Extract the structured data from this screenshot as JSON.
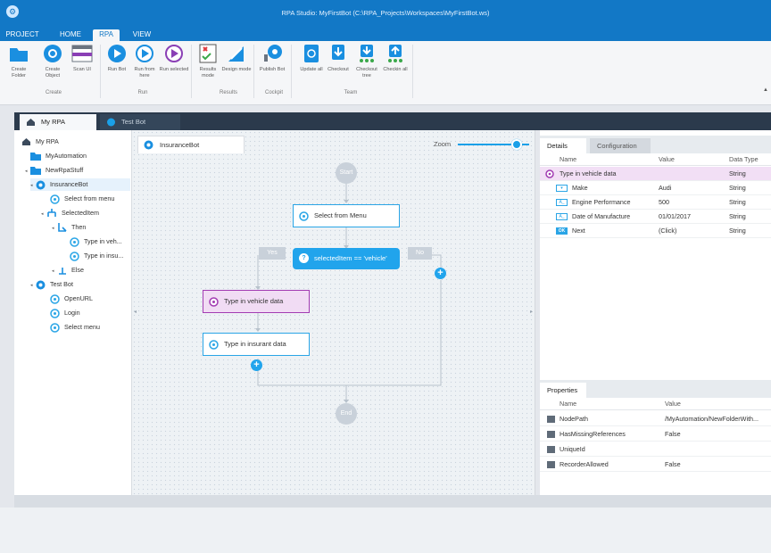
{
  "window": {
    "title": "RPA Studio: MyFirstBot (C:\\RPA_Projects\\Workspaces\\MyFirstBot.ws)"
  },
  "menu_tabs": [
    {
      "label": "PROJECT"
    },
    {
      "label": "HOME"
    },
    {
      "label": "RPA"
    },
    {
      "label": "VIEW"
    }
  ],
  "ribbon": {
    "groups": [
      {
        "label": "Create"
      },
      {
        "label": "Run"
      },
      {
        "label": "Results"
      },
      {
        "label": "Cockpit"
      },
      {
        "label": "Team"
      }
    ],
    "buttons": [
      {
        "label": "Create Folder",
        "icon": "folder-icon"
      },
      {
        "label": "Create Object",
        "icon": "gear-icon"
      },
      {
        "label": "Scan UI",
        "icon": "scan-ui-icon"
      },
      {
        "label": "Run Bot",
        "icon": "play-icon"
      },
      {
        "label": "Run from here",
        "icon": "play-outline-icon"
      },
      {
        "label": "Run selected",
        "icon": "play-selected-icon"
      },
      {
        "label": "Results mode",
        "icon": "results-mode-icon"
      },
      {
        "label": "Design mode",
        "icon": "design-mode-icon"
      },
      {
        "label": "Publish Bot",
        "icon": "publish-icon"
      },
      {
        "label": "Update all",
        "icon": "update-icon"
      },
      {
        "label": "Checkout",
        "icon": "checkout-icon"
      },
      {
        "label": "Checkout tree",
        "icon": "checkout-tree-icon"
      },
      {
        "label": "Checkin all",
        "icon": "checkin-icon"
      }
    ]
  },
  "workspace_tabs": [
    {
      "label": "My RPA"
    },
    {
      "label": "Test Bot"
    }
  ],
  "tree": [
    {
      "label": "My RPA"
    },
    {
      "label": "MyAutomation"
    },
    {
      "label": "NewRpaStuff"
    },
    {
      "label": "InsuranceBot"
    },
    {
      "label": "Select from menu"
    },
    {
      "label": "SelectedItem"
    },
    {
      "label": "Then"
    },
    {
      "label": "Type in veh..."
    },
    {
      "label": "Type in insu..."
    },
    {
      "label": "Else"
    },
    {
      "label": "Test Bot"
    },
    {
      "label": "OpenURL"
    },
    {
      "label": "Login"
    },
    {
      "label": "Select menu"
    }
  ],
  "canvas": {
    "tab_label": "InsuranceBot",
    "zoom_label": "Zoom",
    "zoom_level": 0.75,
    "start_label": "Start",
    "end_label": "End",
    "yes_label": "Yes",
    "no_label": "No",
    "nodes": {
      "select_menu": "Select from Menu",
      "condition": "selectedItem == 'vehicle'",
      "type_vehicle": "Type in vehicle data",
      "type_insurant": "Type in insurant data"
    }
  },
  "details": {
    "tabs": [
      {
        "label": "Details"
      },
      {
        "label": "Configuration"
      }
    ],
    "columns": {
      "name": "Name",
      "value": "Value",
      "type": "Data Type"
    },
    "rows": [
      {
        "name": "Type in vehicle data",
        "value": "",
        "type": "String"
      },
      {
        "name": "Make",
        "value": "Audi",
        "type": "String"
      },
      {
        "name": "Engine Performance",
        "value": "500",
        "type": "String"
      },
      {
        "name": "Date of Manufacture",
        "value": "01/01/2017",
        "type": "String"
      },
      {
        "name": "Next",
        "value": "(Click)",
        "type": "String",
        "badge": "OK"
      }
    ]
  },
  "properties": {
    "tab_label": "Properties",
    "columns": {
      "name": "Name",
      "value": "Value"
    },
    "rows": [
      {
        "name": "NodePath",
        "value": "/MyAutomation/NewFolderWith..."
      },
      {
        "name": "HasMissingReferences",
        "value": "False"
      },
      {
        "name": "UniqueId",
        "value": ""
      },
      {
        "name": "RecorderAllowed",
        "value": "False"
      }
    ]
  },
  "colors": {
    "accent": "#1278c6",
    "activity": "#2aa5e6",
    "selected_activity": "#a23bb2"
  }
}
